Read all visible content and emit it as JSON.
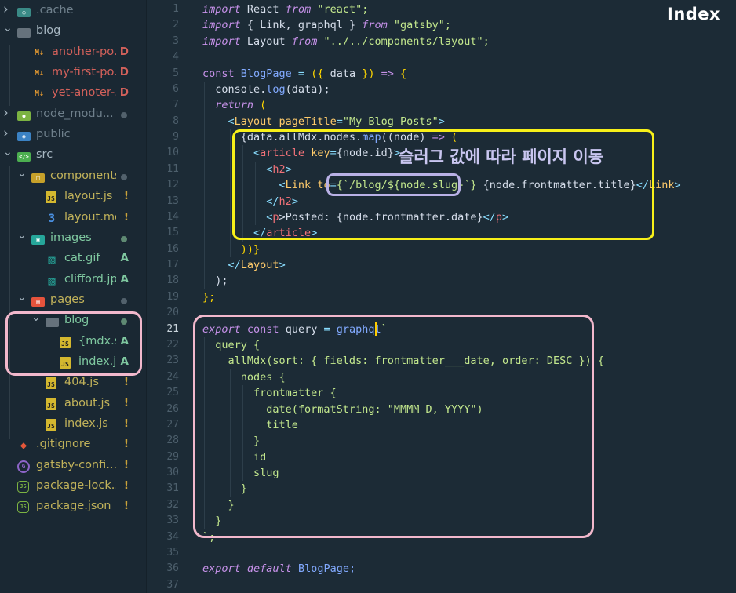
{
  "sidebar": {
    "items": [
      {
        "label": ".cache",
        "chevron": ">",
        "icon": "cache-folder-icon",
        "icon_color": "#3a8a86",
        "text_color": "#6f808c",
        "badge": "",
        "badge_type": "none",
        "indent": 0
      },
      {
        "label": "blog",
        "chevron": "v",
        "icon": "folder-icon",
        "icon_color": "#66727c",
        "text_color": "#a7b7c2",
        "badge": "",
        "badge_type": "none",
        "indent": 0
      },
      {
        "label": "another-po...",
        "chevron": "",
        "icon": "markdown-icon",
        "icon_color": "#f0a030",
        "text_color": "#d3615b",
        "badge": "D",
        "badge_type": "deleted",
        "indent": 1
      },
      {
        "label": "my-first-po...",
        "chevron": "",
        "icon": "markdown-icon",
        "icon_color": "#f0a030",
        "text_color": "#d3615b",
        "badge": "D",
        "badge_type": "deleted",
        "indent": 1
      },
      {
        "label": "yet-anoter-...",
        "chevron": "",
        "icon": "markdown-icon",
        "icon_color": "#f0a030",
        "text_color": "#d3615b",
        "badge": "D",
        "badge_type": "deleted",
        "indent": 1
      },
      {
        "label": "node_modu...",
        "chevron": ">",
        "icon": "node-folder-icon",
        "icon_color": "#7cb342",
        "text_color": "#6f808c",
        "badge": "",
        "badge_type": "dot",
        "indent": 0
      },
      {
        "label": "public",
        "chevron": ">",
        "icon": "public-folder-icon",
        "icon_color": "#3b82c4",
        "text_color": "#6f808c",
        "badge": "",
        "badge_type": "none",
        "indent": 0
      },
      {
        "label": "src",
        "chevron": "v",
        "icon": "src-folder-icon",
        "icon_color": "#4caf50",
        "text_color": "#a7b7c2",
        "badge": "",
        "badge_type": "none",
        "indent": 0
      },
      {
        "label": "components",
        "chevron": "v",
        "icon": "components-folder-icon",
        "icon_color": "#c7a12a",
        "text_color": "#c1b25a",
        "badge": "",
        "badge_type": "dot",
        "indent": 1
      },
      {
        "label": "layout.js",
        "chevron": "",
        "icon": "js-file-icon",
        "icon_color": "#d4b82f",
        "text_color": "#c1b25a",
        "badge": "!",
        "badge_type": "modified",
        "indent": 2
      },
      {
        "label": "layout.mo...",
        "chevron": "",
        "icon": "css-file-icon",
        "icon_color": "#4a90e2",
        "text_color": "#c1b25a",
        "badge": "!",
        "badge_type": "modified",
        "indent": 2
      },
      {
        "label": "images",
        "chevron": "v",
        "icon": "images-folder-icon",
        "icon_color": "#26a69a",
        "text_color": "#7fc8a0",
        "badge": "",
        "badge_type": "dotgreen",
        "indent": 1
      },
      {
        "label": "cat.gif",
        "chevron": "",
        "icon": "image-file-icon",
        "icon_color": "#26a69a",
        "text_color": "#7fc8a0",
        "badge": "A",
        "badge_type": "added",
        "indent": 2
      },
      {
        "label": "clifford.jpg",
        "chevron": "",
        "icon": "image-file-icon",
        "icon_color": "#26a69a",
        "text_color": "#7fc8a0",
        "badge": "A",
        "badge_type": "added",
        "indent": 2
      },
      {
        "label": "pages",
        "chevron": "v",
        "icon": "pages-folder-icon",
        "icon_color": "#e5533c",
        "text_color": "#c1b25a",
        "badge": "",
        "badge_type": "dot",
        "indent": 1
      },
      {
        "label": "blog",
        "chevron": "v",
        "icon": "folder-icon",
        "icon_color": "#66727c",
        "text_color": "#7fc8a0",
        "badge": "",
        "badge_type": "dotgreen",
        "indent": 2
      },
      {
        "label": "{mdx.slu...",
        "chevron": "",
        "icon": "js-file-icon",
        "icon_color": "#d4b82f",
        "text_color": "#7fc8a0",
        "badge": "A",
        "badge_type": "added",
        "indent": 3
      },
      {
        "label": "index.js",
        "chevron": "",
        "icon": "js-file-icon",
        "icon_color": "#d4b82f",
        "text_color": "#7fc8a0",
        "badge": "A",
        "badge_type": "added",
        "indent": 3
      },
      {
        "label": "404.js",
        "chevron": "",
        "icon": "js-file-icon",
        "icon_color": "#d4b82f",
        "text_color": "#c1b25a",
        "badge": "!",
        "badge_type": "modified",
        "indent": 2
      },
      {
        "label": "about.js",
        "chevron": "",
        "icon": "js-file-icon",
        "icon_color": "#d4b82f",
        "text_color": "#c1b25a",
        "badge": "!",
        "badge_type": "modified",
        "indent": 2
      },
      {
        "label": "index.js",
        "chevron": "",
        "icon": "js-file-icon",
        "icon_color": "#d4b82f",
        "text_color": "#c1b25a",
        "badge": "!",
        "badge_type": "modified",
        "indent": 2
      },
      {
        "label": ".gitignore",
        "chevron": "",
        "icon": "git-icon",
        "icon_color": "#e4573a",
        "text_color": "#c1b25a",
        "badge": "!",
        "badge_type": "modified",
        "indent": 0
      },
      {
        "label": "gatsby-confi...",
        "chevron": "",
        "icon": "gatsby-icon",
        "icon_color": "#8e65c9",
        "text_color": "#c1b25a",
        "badge": "!",
        "badge_type": "modified",
        "indent": 0
      },
      {
        "label": "package-lock...",
        "chevron": "",
        "icon": "nodejs-icon",
        "icon_color": "#7cb342",
        "text_color": "#c1b25a",
        "badge": "!",
        "badge_type": "modified",
        "indent": 0
      },
      {
        "label": "package.json",
        "chevron": "",
        "icon": "nodejs-icon",
        "icon_color": "#7cb342",
        "text_color": "#c1b25a",
        "badge": "!",
        "badge_type": "modified",
        "indent": 0
      }
    ]
  },
  "editor": {
    "overlay_title": "Index",
    "annotation_text": "슬러그 값에 따라 페이지 이동",
    "current_line": "21",
    "line_numbers": [
      "1",
      "2",
      "3",
      "4",
      "5",
      "6",
      "7",
      "8",
      "9",
      "10",
      "11",
      "12",
      "13",
      "14",
      "15",
      "16",
      "17",
      "18",
      "19",
      "20",
      "21",
      "22",
      "23",
      "24",
      "25",
      "26",
      "27",
      "28",
      "29",
      "30",
      "31",
      "32",
      "33",
      "34",
      "35",
      "36",
      "37"
    ],
    "lines": [
      [
        [
          "import",
          "kw"
        ],
        [
          " React ",
          "pl"
        ],
        [
          "from",
          "kw"
        ],
        [
          " \"react\";",
          "str"
        ]
      ],
      [
        [
          "import",
          "kw"
        ],
        [
          " { Link, graphql } ",
          "pl"
        ],
        [
          "from",
          "kw"
        ],
        [
          " \"gatsby\";",
          "str"
        ]
      ],
      [
        [
          "import",
          "kw"
        ],
        [
          " Layout ",
          "pl"
        ],
        [
          "from",
          "kw"
        ],
        [
          " \"../../components/layout\";",
          "str"
        ]
      ],
      [],
      [
        [
          "const",
          "kwn"
        ],
        [
          " BlogPage ",
          "blue"
        ],
        [
          "=",
          "op"
        ],
        [
          " ({ ",
          "br"
        ],
        [
          "data",
          "pl"
        ],
        [
          " }) ",
          "br"
        ],
        [
          "=>",
          "kwn"
        ],
        [
          " {",
          "br"
        ]
      ],
      [
        [
          "  console.",
          "pl"
        ],
        [
          "log",
          "fn"
        ],
        [
          "(data);",
          "pl"
        ]
      ],
      [
        [
          "  ",
          "pl"
        ],
        [
          "return",
          "kw"
        ],
        [
          " (",
          "br"
        ]
      ],
      [
        [
          "    <",
          "cyan"
        ],
        [
          "Layout",
          "attr"
        ],
        [
          " pageTitle",
          "attr"
        ],
        [
          "=",
          "op"
        ],
        [
          "\"My Blog Posts\"",
          "str"
        ],
        [
          ">",
          "cyan"
        ]
      ],
      [
        [
          "      {data.allMdx.nodes.",
          "pl"
        ],
        [
          "map",
          "fn"
        ],
        [
          "((node) ",
          "pl"
        ],
        [
          "=>",
          "kwn"
        ],
        [
          " (",
          "br"
        ]
      ],
      [
        [
          "        <",
          "cyan"
        ],
        [
          "article",
          "tag"
        ],
        [
          " key",
          "attr"
        ],
        [
          "=",
          "op"
        ],
        [
          "{node.id}",
          "pl"
        ],
        [
          ">",
          "cyan"
        ]
      ],
      [
        [
          "          <",
          "cyan"
        ],
        [
          "h2",
          "tag"
        ],
        [
          ">",
          "cyan"
        ]
      ],
      [
        [
          "            <",
          "cyan"
        ],
        [
          "Link",
          "attr"
        ],
        [
          " to",
          "attr"
        ],
        [
          "=",
          "op"
        ],
        [
          "{`/blog/${node.slug}`}",
          "str"
        ],
        [
          " {node.frontmatter.title}",
          "pl"
        ],
        [
          "</",
          "cyan"
        ],
        [
          "Link",
          "attr"
        ],
        [
          ">",
          "cyan"
        ]
      ],
      [
        [
          "          </",
          "cyan"
        ],
        [
          "h2",
          "tag"
        ],
        [
          ">",
          "cyan"
        ]
      ],
      [
        [
          "          <",
          "cyan"
        ],
        [
          "p",
          "tag"
        ],
        [
          ">Posted: {node.frontmatter.date}",
          "pl"
        ],
        [
          "</",
          "cyan"
        ],
        [
          "p",
          "tag"
        ],
        [
          ">",
          "cyan"
        ]
      ],
      [
        [
          "        </",
          "cyan"
        ],
        [
          "article",
          "tag"
        ],
        [
          ">",
          "cyan"
        ]
      ],
      [
        [
          "      ))}",
          "br"
        ]
      ],
      [
        [
          "    </",
          "cyan"
        ],
        [
          "Layout",
          "attr"
        ],
        [
          ">",
          "cyan"
        ]
      ],
      [
        [
          "  );",
          "pl"
        ]
      ],
      [
        [
          "};",
          "br"
        ]
      ],
      [],
      [
        [
          "export",
          "kw"
        ],
        [
          " const ",
          "kwn"
        ],
        [
          "query ",
          "pl"
        ],
        [
          "=",
          "op"
        ],
        [
          " graphql",
          "fn"
        ],
        [
          "`",
          "str"
        ]
      ],
      [
        [
          "  query {",
          "str"
        ]
      ],
      [
        [
          "    allMdx(sort: { fields: frontmatter___date, order: DESC }) {",
          "str"
        ]
      ],
      [
        [
          "      nodes {",
          "str"
        ]
      ],
      [
        [
          "        frontmatter {",
          "str"
        ]
      ],
      [
        [
          "          date(formatString: \"MMMM D, YYYY\")",
          "str"
        ]
      ],
      [
        [
          "          title",
          "str"
        ]
      ],
      [
        [
          "        }",
          "str"
        ]
      ],
      [
        [
          "        id",
          "str"
        ]
      ],
      [
        [
          "        slug",
          "str"
        ]
      ],
      [
        [
          "      }",
          "str"
        ]
      ],
      [
        [
          "    }",
          "str"
        ]
      ],
      [
        [
          "  }",
          "str"
        ]
      ],
      [
        [
          "`;",
          "str"
        ]
      ],
      [],
      [
        [
          "export",
          "kw"
        ],
        [
          " default ",
          "kw"
        ],
        [
          "BlogPage;",
          "blue"
        ]
      ],
      []
    ]
  },
  "colors": {
    "yellow_box": "#f7f019",
    "pink_box": "#f2b8cc",
    "lavender_box": "#b9b1e6",
    "annotation_text": "#c9c6f0"
  }
}
